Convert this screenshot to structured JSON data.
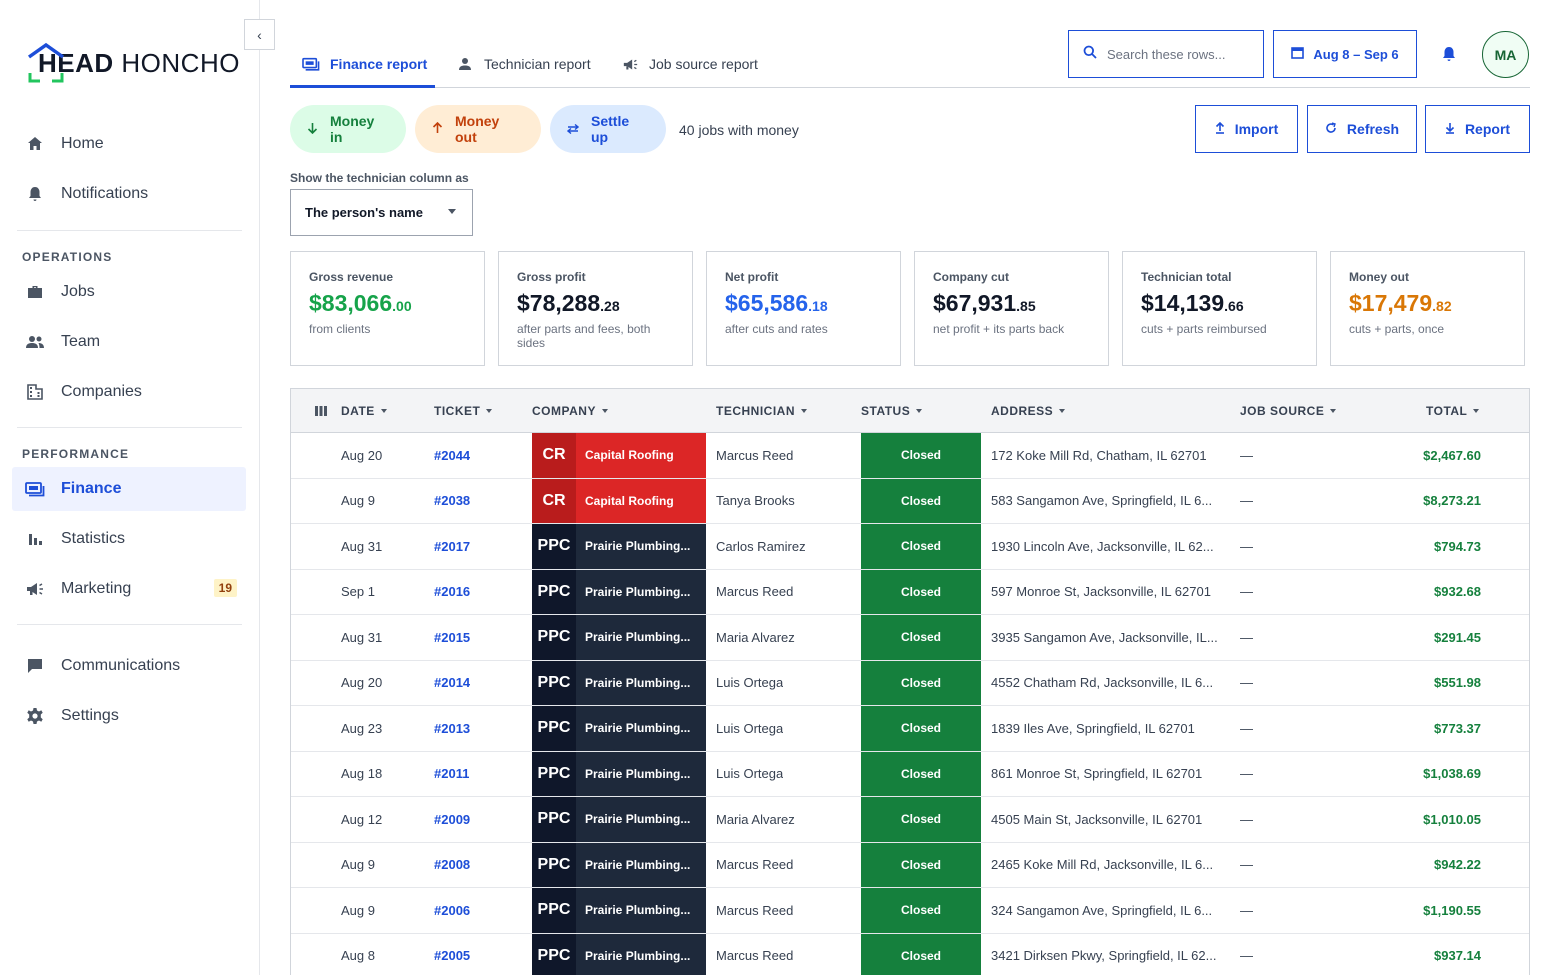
{
  "brand": {
    "logo_bold": "HEAD",
    "logo_rest": " HONCHO"
  },
  "sidebar": {
    "top_items": [
      {
        "label": "Home",
        "icon": "home-icon"
      },
      {
        "label": "Notifications",
        "icon": "bell-icon"
      }
    ],
    "operations_label": "OPERATIONS",
    "operations_items": [
      {
        "label": "Jobs",
        "icon": "briefcase-icon"
      },
      {
        "label": "Team",
        "icon": "people-icon"
      },
      {
        "label": "Companies",
        "icon": "building-icon"
      }
    ],
    "performance_label": "PERFORMANCE",
    "performance_items": [
      {
        "label": "Finance",
        "icon": "finance-icon",
        "active": true
      },
      {
        "label": "Statistics",
        "icon": "bar-chart-icon"
      },
      {
        "label": "Marketing",
        "icon": "megaphone-icon",
        "badge": "19"
      }
    ],
    "bottom_items": [
      {
        "label": "Communications",
        "icon": "chat-icon"
      },
      {
        "label": "Settings",
        "icon": "gear-icon"
      }
    ]
  },
  "tabs": [
    {
      "label": "Finance report",
      "active": true
    },
    {
      "label": "Technician report"
    },
    {
      "label": "Job source report"
    }
  ],
  "header": {
    "search_placeholder": "Search these rows...",
    "date_range": "Aug 8 – Sep 6",
    "avatar_initials": "MA"
  },
  "actions": {
    "money_in": "Money in",
    "money_out": "Money out",
    "settle_up": "Settle up",
    "jobs_count": "40 jobs with money",
    "import": "Import",
    "refresh": "Refresh",
    "report": "Report"
  },
  "tech_column": {
    "label": "Show the technician column as",
    "value": "The person's name"
  },
  "colors": {
    "accent": "#1d4ed8",
    "green": "#15803d",
    "orange": "#d97706",
    "cr_red": "#dc2626",
    "ppc_navy": "#1e293b"
  },
  "stats": [
    {
      "label": "Gross revenue",
      "whole": "$83,066",
      "cents": ".00",
      "sub": "from clients",
      "color": "#16a34a"
    },
    {
      "label": "Gross profit",
      "whole": "$78,288",
      "cents": ".28",
      "sub": "after parts and fees, both sides",
      "color": "#111827"
    },
    {
      "label": "Net profit",
      "whole": "$65,586",
      "cents": ".18",
      "sub": "after cuts and rates",
      "color": "#2563eb"
    },
    {
      "label": "Company cut",
      "whole": "$67,931",
      "cents": ".85",
      "sub": "net profit + its parts back",
      "color": "#111827"
    },
    {
      "label": "Technician total",
      "whole": "$14,139",
      "cents": ".66",
      "sub": "cuts + parts reimbursed",
      "color": "#111827"
    },
    {
      "label": "Money out",
      "whole": "$17,479",
      "cents": ".82",
      "sub": "cuts + parts, once",
      "color": "#d97706"
    }
  ],
  "table": {
    "columns": [
      "DATE",
      "TICKET",
      "COMPANY",
      "TECHNICIAN",
      "STATUS",
      "ADDRESS",
      "JOB SOURCE",
      "TOTAL"
    ],
    "rows": [
      {
        "date": "Aug 20",
        "ticket": "#2044",
        "abbr": "CR",
        "company": "Capital Roofing",
        "tech": "Marcus Reed",
        "status": "Closed",
        "address": "172 Koke Mill Rd, Chatham, IL 62701",
        "source": "—",
        "total": "$2,467.60"
      },
      {
        "date": "Aug 9",
        "ticket": "#2038",
        "abbr": "CR",
        "company": "Capital Roofing",
        "tech": "Tanya Brooks",
        "status": "Closed",
        "address": "583 Sangamon Ave, Springfield, IL 6...",
        "source": "—",
        "total": "$8,273.21"
      },
      {
        "date": "Aug 31",
        "ticket": "#2017",
        "abbr": "PPC",
        "company": "Prairie Plumbing...",
        "tech": "Carlos Ramirez",
        "status": "Closed",
        "address": "1930 Lincoln Ave, Jacksonville, IL 62...",
        "source": "—",
        "total": "$794.73"
      },
      {
        "date": "Sep 1",
        "ticket": "#2016",
        "abbr": "PPC",
        "company": "Prairie Plumbing...",
        "tech": "Marcus Reed",
        "status": "Closed",
        "address": "597 Monroe St, Jacksonville, IL 62701",
        "source": "—",
        "total": "$932.68"
      },
      {
        "date": "Aug 31",
        "ticket": "#2015",
        "abbr": "PPC",
        "company": "Prairie Plumbing...",
        "tech": "Maria Alvarez",
        "status": "Closed",
        "address": "3935 Sangamon Ave, Jacksonville, IL...",
        "source": "—",
        "total": "$291.45"
      },
      {
        "date": "Aug 20",
        "ticket": "#2014",
        "abbr": "PPC",
        "company": "Prairie Plumbing...",
        "tech": "Luis Ortega",
        "status": "Closed",
        "address": "4552 Chatham Rd, Jacksonville, IL 6...",
        "source": "—",
        "total": "$551.98"
      },
      {
        "date": "Aug 23",
        "ticket": "#2013",
        "abbr": "PPC",
        "company": "Prairie Plumbing...",
        "tech": "Luis Ortega",
        "status": "Closed",
        "address": "1839 Iles Ave, Springfield, IL 62701",
        "source": "—",
        "total": "$773.37"
      },
      {
        "date": "Aug 18",
        "ticket": "#2011",
        "abbr": "PPC",
        "company": "Prairie Plumbing...",
        "tech": "Luis Ortega",
        "status": "Closed",
        "address": "861 Monroe St, Springfield, IL 62701",
        "source": "—",
        "total": "$1,038.69"
      },
      {
        "date": "Aug 12",
        "ticket": "#2009",
        "abbr": "PPC",
        "company": "Prairie Plumbing...",
        "tech": "Maria Alvarez",
        "status": "Closed",
        "address": "4505 Main St, Jacksonville, IL 62701",
        "source": "—",
        "total": "$1,010.05"
      },
      {
        "date": "Aug 9",
        "ticket": "#2008",
        "abbr": "PPC",
        "company": "Prairie Plumbing...",
        "tech": "Marcus Reed",
        "status": "Closed",
        "address": "2465 Koke Mill Rd, Jacksonville, IL 6...",
        "source": "—",
        "total": "$942.22"
      },
      {
        "date": "Aug 9",
        "ticket": "#2006",
        "abbr": "PPC",
        "company": "Prairie Plumbing...",
        "tech": "Marcus Reed",
        "status": "Closed",
        "address": "324 Sangamon Ave, Springfield, IL 6...",
        "source": "—",
        "total": "$1,190.55"
      },
      {
        "date": "Aug 8",
        "ticket": "#2005",
        "abbr": "PPC",
        "company": "Prairie Plumbing...",
        "tech": "Marcus Reed",
        "status": "Closed",
        "address": "3421 Dirksen Pkwy, Springfield, IL 62...",
        "source": "—",
        "total": "$937.14"
      }
    ]
  }
}
